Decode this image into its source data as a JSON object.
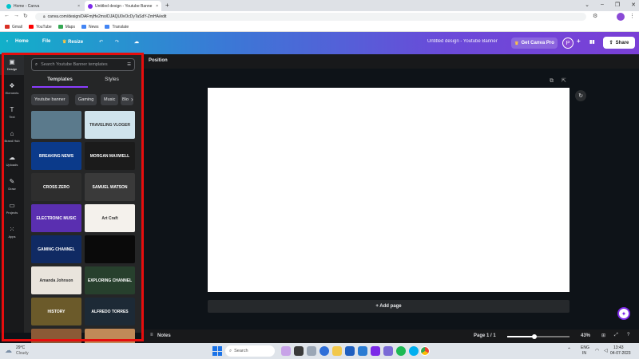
{
  "browser": {
    "tabs": [
      {
        "title": "Home - Canva",
        "close": "×"
      },
      {
        "title": "Untitled design - Youtube Banne",
        "close": "×"
      }
    ],
    "new_tab": "+",
    "window_controls": [
      "⌄",
      "–",
      "❐",
      "✕"
    ],
    "url": "canva.com/design/DAFmjHe2mo/DJAQU0vOcDyTaSdY-ZmHA/edit",
    "bookmarks": [
      {
        "label": "Gmail",
        "color": "#d93025"
      },
      {
        "label": "YouTube",
        "color": "#ff0000"
      },
      {
        "label": "Maps",
        "color": "#34a853"
      },
      {
        "label": "News",
        "color": "#4285f4"
      },
      {
        "label": "Translate",
        "color": "#4285f4"
      }
    ]
  },
  "header": {
    "home": "Home",
    "file": "File",
    "resize": "Resize",
    "design_title": "Untitled design - Youtube Banner",
    "get_pro": "Get Canva Pro",
    "avatar_letter": "P",
    "share": "Share"
  },
  "rail": {
    "items": [
      {
        "label": "Design",
        "icon": "layout-icon",
        "glyph": "▣"
      },
      {
        "label": "Elements",
        "icon": "shapes-icon",
        "glyph": "❖"
      },
      {
        "label": "Text",
        "icon": "text-icon",
        "glyph": "T"
      },
      {
        "label": "Brand Hub",
        "icon": "brand-icon",
        "glyph": "⌂"
      },
      {
        "label": "Uploads",
        "icon": "cloud-upload-icon",
        "glyph": "☁"
      },
      {
        "label": "Draw",
        "icon": "pen-icon",
        "glyph": "✎"
      },
      {
        "label": "Projects",
        "icon": "folder-icon",
        "glyph": "▭"
      },
      {
        "label": "Apps",
        "icon": "apps-grid-icon",
        "glyph": "⁙"
      }
    ]
  },
  "panel": {
    "search_placeholder": "Search Youtube Banner templates",
    "tabs": [
      "Templates",
      "Styles"
    ],
    "chips": [
      "Youtube banner",
      "Gaming",
      "Music",
      "Blo"
    ],
    "templates": [
      {
        "text": "",
        "bg": "#5b7a8c"
      },
      {
        "text": "TRAVELING VLOGER",
        "bg": "#cfe3ec"
      },
      {
        "text": "BREAKING NEWS",
        "bg": "#0b3a8a"
      },
      {
        "text": "MORGAN MAXWELL",
        "bg": "#1b1b1b"
      },
      {
        "text": "CROSS ZERO",
        "bg": "#2e2e2e"
      },
      {
        "text": "SAMUEL WATSON",
        "bg": "#3a3a3a"
      },
      {
        "text": "ELECTRONIC MUSIC",
        "bg": "#5a2fb0"
      },
      {
        "text": "Art Craft",
        "bg": "#f4f1ec"
      },
      {
        "text": "GAMING CHANNEL",
        "bg": "#102a63"
      },
      {
        "text": "",
        "bg": "#0a0a0a"
      },
      {
        "text": "Amanda Johnson",
        "bg": "#e9e4dc"
      },
      {
        "text": "EXPLORING CHANNEL",
        "bg": "#27402d"
      },
      {
        "text": "HISTORY",
        "bg": "#6b5a2a"
      },
      {
        "text": "ALFREDO TORRES",
        "bg": "#1d2a36"
      },
      {
        "text": "",
        "bg": "#8b5a36"
      },
      {
        "text": "",
        "bg": "#c08a58"
      }
    ]
  },
  "toolbar": {
    "position": "Position"
  },
  "canvas": {
    "add_page": "+ Add page"
  },
  "bottom": {
    "notes": "Notes",
    "page": "Page 1 / 1",
    "zoom": "43%",
    "zoom_level": 0.43
  },
  "taskbar": {
    "weather_temp": "29°C",
    "weather_desc": "Cloudy",
    "search": "Search",
    "lang": "ENG",
    "region": "IN",
    "time": "13:43",
    "date": "04-07-2023"
  },
  "colors": {
    "accent": "#8b3dff",
    "highlight": "#e60d0d"
  }
}
